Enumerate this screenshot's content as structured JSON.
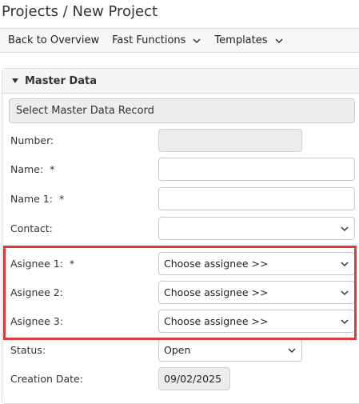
{
  "page": {
    "title": "Projects / New Project"
  },
  "toolbar": {
    "back_label": "Back to Overview",
    "fast_functions_label": "Fast Functions",
    "templates_label": "Templates"
  },
  "panel": {
    "header": "Master Data",
    "select_record_label": "Select Master Data Record"
  },
  "form": {
    "number": {
      "label": "Number:",
      "value": ""
    },
    "name": {
      "label": "Name:",
      "required": "*",
      "value": ""
    },
    "name1": {
      "label": "Name 1:",
      "required": "*",
      "value": ""
    },
    "contact": {
      "label": "Contact:",
      "value": ""
    },
    "assignee1": {
      "label": "Asignee 1:",
      "required": "*",
      "value": "Choose assignee >>"
    },
    "assignee2": {
      "label": "Asignee 2:",
      "value": "Choose assignee >>"
    },
    "assignee3": {
      "label": "Asignee 3:",
      "value": "Choose assignee >>"
    },
    "status": {
      "label": "Status:",
      "value": "Open"
    },
    "creation_date": {
      "label": "Creation Date:",
      "value": "09/02/2025"
    }
  },
  "colors": {
    "highlight": "#e0393b"
  },
  "icons": {
    "dropdown": "chevron-down-icon",
    "collapse": "triangle-down-icon"
  }
}
